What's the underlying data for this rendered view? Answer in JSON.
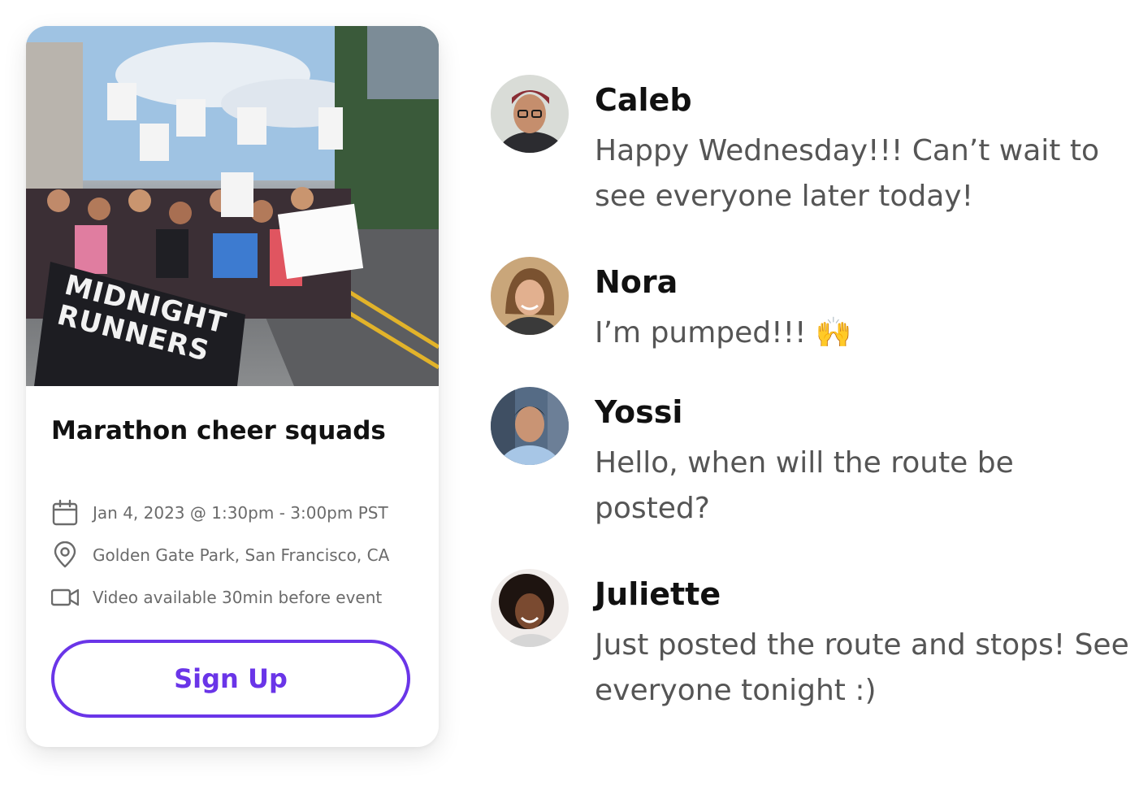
{
  "event": {
    "hero_banner_text": "MIDNIGHT RUNNERS",
    "title": "Marathon cheer squads",
    "date": "Jan 4, 2023 @ 1:30pm - 3:00pm PST",
    "location": "Golden Gate Park, San Francisco, CA",
    "video": "Video available 30min before event",
    "signup_label": "Sign Up",
    "accent_color": "#6a35e8"
  },
  "messages": [
    {
      "name": "Caleb",
      "text": "Happy Wednesday!!! Can’t wait to see everyone later today!"
    },
    {
      "name": "Nora",
      "text": "I’m pumped!!! 🙌"
    },
    {
      "name": "Yossi",
      "text": "Hello, when will the route be posted?"
    },
    {
      "name": "Juliette",
      "text": "Just posted the route and stops! See everyone tonight :)"
    }
  ]
}
